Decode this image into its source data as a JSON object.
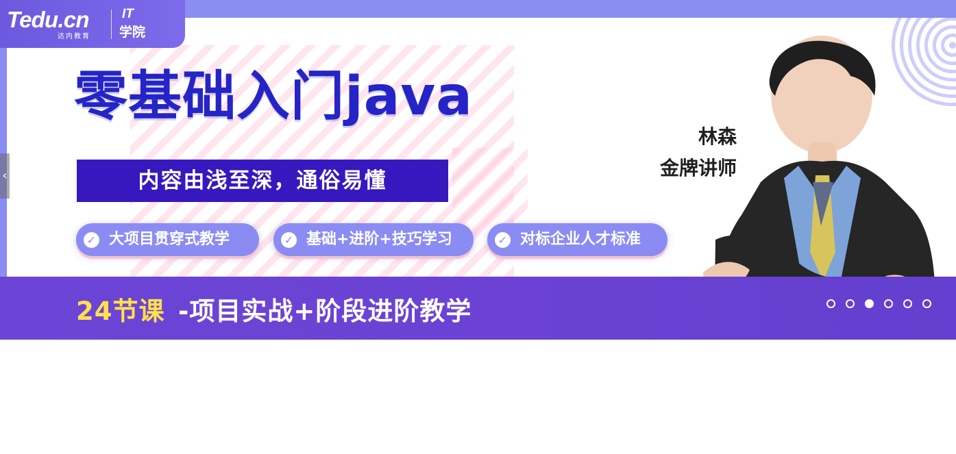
{
  "banner": {
    "logo": {
      "brand": "Tedu.cn",
      "brand_sub": "达内教育",
      "it": "IT",
      "school": "学院"
    },
    "headline": "零基础入门java",
    "subtitle": "内容由浅至深，通俗易懂",
    "tags": [
      {
        "label": "大项目贯穿式教学",
        "icon": "check-icon"
      },
      {
        "label": "基础+进阶+技巧学习",
        "icon": "check-icon"
      },
      {
        "label": "对标企业人才标准",
        "icon": "check-icon"
      }
    ],
    "bottom": {
      "lead": "24节课",
      "text": "-项目实战+阶段进阶教学"
    },
    "instructor": {
      "name": "林森",
      "title": "金牌讲师"
    }
  },
  "carousel": {
    "prev_label": "‹",
    "dot_count": 6,
    "active_dot_index": 2
  },
  "colors": {
    "brand_purple": "#6c45d6",
    "headline_blue": "#2524c7",
    "subtitle_bg": "#3718bf",
    "tag_bg": "#8b8cf3",
    "accent_yellow": "#ffe14b"
  }
}
